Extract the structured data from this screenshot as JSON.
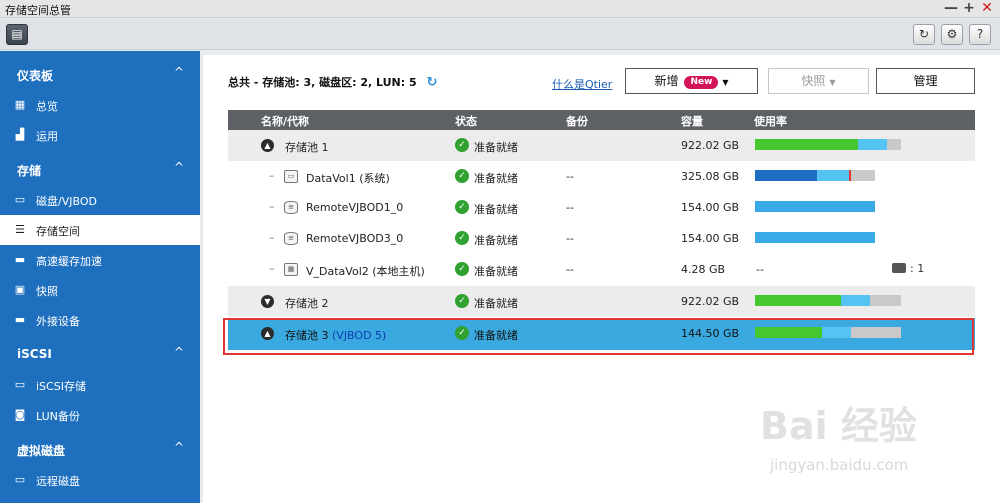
{
  "window": {
    "title": "存储空间总管",
    "min": "—",
    "max": "+",
    "close": "✕"
  },
  "toolbar": {
    "layout_icon": "▤",
    "refresh_icon": "↻",
    "gear_icon": "⚙",
    "help": "?"
  },
  "sidebar": {
    "sections": [
      {
        "label": "仪表板",
        "chev": "^"
      },
      {
        "label": "存储",
        "chev": "^"
      },
      {
        "label": "iSCSI",
        "chev": "^"
      },
      {
        "label": "虚拟磁盘",
        "chev": "^"
      }
    ],
    "items": [
      {
        "label": "总览",
        "icon": "▦"
      },
      {
        "label": "运用",
        "icon": "▟"
      },
      {
        "label": "磁盘/VJBOD",
        "icon": "▭"
      },
      {
        "label": "存储空间",
        "icon": "☰"
      },
      {
        "label": "高速缓存加速",
        "icon": "▬"
      },
      {
        "label": "快照",
        "icon": "▣"
      },
      {
        "label": "外接设备",
        "icon": "▬"
      },
      {
        "label": "iSCSI存储",
        "icon": "▭"
      },
      {
        "label": "LUN备份",
        "icon": "◙"
      },
      {
        "label": "远程磁盘",
        "icon": "▭"
      }
    ]
  },
  "main": {
    "summary": "总共 - 存储池: 3, 磁盘区: 2, LUN: 5",
    "refresh_icon": "↻",
    "qtier_link": "什么是Qtier",
    "new_button": "新增",
    "new_badge": "New",
    "snapshot_button": "快照",
    "manage_button": "管理",
    "caret": "▼"
  },
  "table": {
    "headers": {
      "name": "名称/代称",
      "status": "状态",
      "backup": "备份",
      "capacity": "容量",
      "usage": "使用率"
    },
    "rows": [
      {
        "name": "存储池 1",
        "status": "准备就绪",
        "backup": "",
        "capacity": "922.02 GB",
        "usage": 0.7
      },
      {
        "name": "DataVol1 (系统)",
        "status": "准备就绪",
        "backup": "--",
        "capacity": "325.08 GB",
        "usage": 0.5
      },
      {
        "name": "RemoteVJBOD1_0",
        "status": "准备就绪",
        "backup": "--",
        "capacity": "154.00 GB",
        "usage": 1.0
      },
      {
        "name": "RemoteVJBOD3_0",
        "status": "准备就绪",
        "backup": "--",
        "capacity": "154.00 GB",
        "usage": 1.0
      },
      {
        "name": "V_DataVol2 (本地主机)",
        "status": "准备就绪",
        "backup": "--",
        "capacity": "4.28 GB",
        "usage_text": "--",
        "snapshot_count": "1"
      },
      {
        "name": "存储池 2",
        "status": "准备就绪",
        "backup": "",
        "capacity": "922.02 GB",
        "usage": 0.59
      },
      {
        "name": "存储池 3",
        "name_suffix": "(VJBOD 5)",
        "status": "准备就绪",
        "backup": "",
        "capacity": "144.50 GB",
        "usage": 0.46
      }
    ]
  },
  "colors": {
    "sidebar": "#1e70bf",
    "green": "#47c72f",
    "light_blue": "#56c4f2",
    "dark_blue": "#1e6fc4",
    "highlight": "#e03636"
  },
  "watermark": {
    "line1": "Bai 经验",
    "line2": "jingyan.baidu.com"
  }
}
